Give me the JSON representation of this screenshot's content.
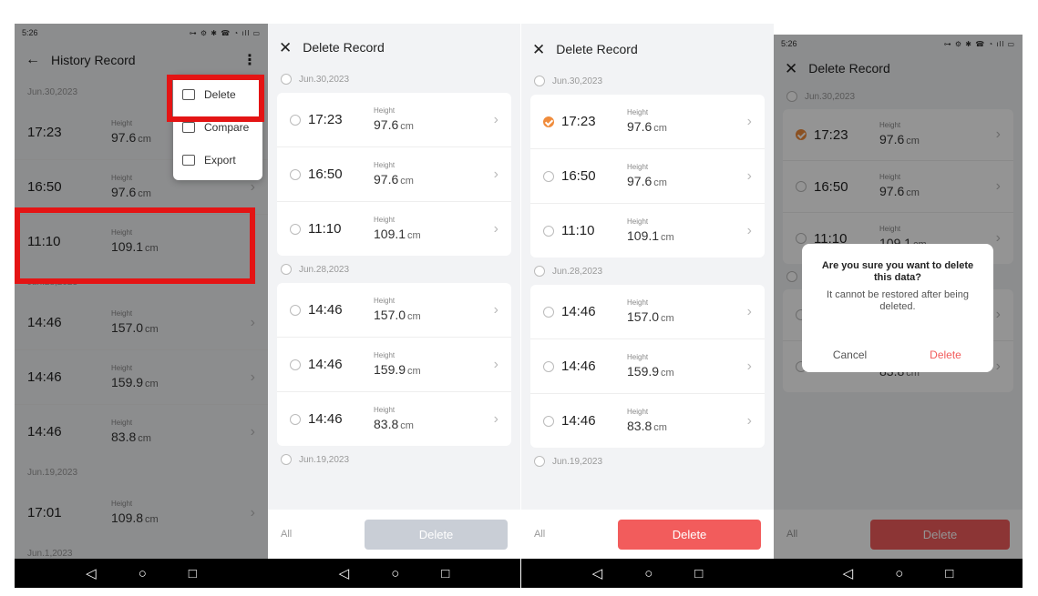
{
  "panel1": {
    "status_time": "5:26",
    "status_icons": "⊶ ⚙ ✱ ☎ ◔ ıll ▭",
    "title": "History Record",
    "menu": [
      "Delete",
      "Compare",
      "Export"
    ],
    "groups": [
      {
        "date": "Jun.30,2023",
        "rows": [
          {
            "time": "17:23",
            "label": "Height",
            "value": "97.6",
            "unit": "cm"
          },
          {
            "time": "16:50",
            "label": "Height",
            "value": "97.6",
            "unit": "cm"
          },
          {
            "time": "11:10",
            "label": "Height",
            "value": "109.1",
            "unit": "cm"
          }
        ]
      },
      {
        "date": "Jun.28,2023",
        "rows": [
          {
            "time": "14:46",
            "label": "Height",
            "value": "157.0",
            "unit": "cm"
          },
          {
            "time": "14:46",
            "label": "Height",
            "value": "159.9",
            "unit": "cm"
          },
          {
            "time": "14:46",
            "label": "Height",
            "value": "83.8",
            "unit": "cm"
          }
        ]
      },
      {
        "date": "Jun.19,2023",
        "rows": [
          {
            "time": "17:01",
            "label": "Height",
            "value": "109.8",
            "unit": "cm"
          }
        ]
      }
    ],
    "next_date": "Jun.1,2023"
  },
  "delete_screen": {
    "title": "Delete Record",
    "groups": [
      {
        "date": "Jun.30,2023",
        "rows": [
          {
            "time": "17:23",
            "label": "Height",
            "value": "97.6",
            "unit": "cm"
          },
          {
            "time": "16:50",
            "label": "Height",
            "value": "97.6",
            "unit": "cm"
          },
          {
            "time": "11:10",
            "label": "Height",
            "value": "109.1",
            "unit": "cm"
          }
        ]
      },
      {
        "date": "Jun.28,2023",
        "rows": [
          {
            "time": "14:46",
            "label": "Height",
            "value": "157.0",
            "unit": "cm"
          },
          {
            "time": "14:46",
            "label": "Height",
            "value": "159.9",
            "unit": "cm"
          },
          {
            "time": "14:46",
            "label": "Height",
            "value": "83.8",
            "unit": "cm"
          }
        ]
      }
    ],
    "next_date": "Jun.19,2023",
    "all_label": "All",
    "delete_label": "Delete"
  },
  "dialog": {
    "title": "Are you sure you want to delete this data?",
    "message": "It cannot be restored after being deleted.",
    "cancel": "Cancel",
    "delete": "Delete"
  },
  "navbar": {
    "back": "◁",
    "home": "○",
    "recents": "□"
  },
  "colors": {
    "accent_red": "#f25c5c",
    "check_orange": "#f08c3c",
    "highlight": "#e41414"
  }
}
